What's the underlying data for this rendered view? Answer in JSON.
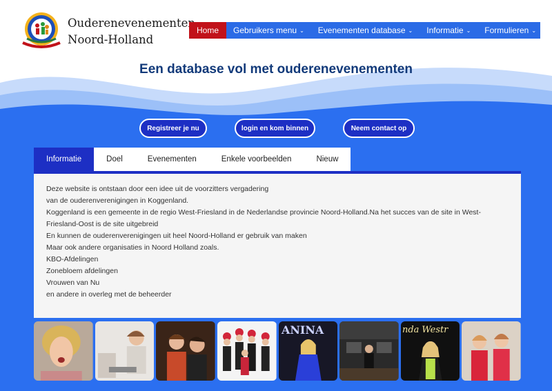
{
  "header": {
    "site_name_line1": "Ouderenevenementen",
    "site_name_line2": "Noord-Holland"
  },
  "nav": {
    "items": [
      {
        "label": "Home",
        "active": true,
        "dropdown": false
      },
      {
        "label": "Gebruikers menu",
        "active": false,
        "dropdown": true
      },
      {
        "label": "Evenementen database",
        "active": false,
        "dropdown": true
      },
      {
        "label": "Informatie",
        "active": false,
        "dropdown": true
      },
      {
        "label": "Formulieren",
        "active": false,
        "dropdown": true
      }
    ],
    "chevron": "chevron-down-icon"
  },
  "hero": {
    "title": "Een database vol met ouderenevenementen"
  },
  "cta": {
    "register": "Registreer je nu",
    "login": "login en kom binnen",
    "contact": "Neem contact op"
  },
  "tabs": [
    {
      "label": "Informatie",
      "active": true
    },
    {
      "label": "Doel",
      "active": false
    },
    {
      "label": "Evenementen",
      "active": false
    },
    {
      "label": "Enkele voorbeelden",
      "active": false
    },
    {
      "label": "Nieuw",
      "active": false
    }
  ],
  "panel": {
    "lines": [
      "Deze website is ontstaan door een idee uit de voorzitters vergadering",
      "van de ouderenverenigingen in Koggenland.",
      "Koggenland is een gemeente in de regio West-Friesland in de Nederlandse provincie Noord-Holland.Na het succes van de site in West-Friesland-Oost is de site uitgebreid",
      "En kunnen de ouderenverenigingen uit heel Noord-Holland er gebruik van maken",
      "Maar ook andere organisaties in Noord Holland zoals.",
      "KBO-Afdelingen",
      "Zonebloem afdelingen",
      "Vrouwen van Nu",
      "en andere in overleg met de beheerder"
    ]
  },
  "gallery": {
    "items": [
      {
        "name": "gallery-photo-singer-woman"
      },
      {
        "name": "gallery-photo-duo-women"
      },
      {
        "name": "gallery-photo-performers-stage"
      },
      {
        "name": "gallery-photo-group-red-hats"
      },
      {
        "name": "gallery-photo-anina",
        "caption": "ANINA"
      },
      {
        "name": "gallery-photo-stage-performer"
      },
      {
        "name": "gallery-photo-linda-westra",
        "caption": "nda Westr"
      },
      {
        "name": "gallery-photo-two-ladies-red"
      }
    ]
  },
  "colors": {
    "nav_bg": "#2b6be6",
    "nav_active": "#c1121a",
    "hero_blue": "#2b6ff0",
    "button_bg": "#1d2fc4",
    "title": "#123a7a"
  }
}
